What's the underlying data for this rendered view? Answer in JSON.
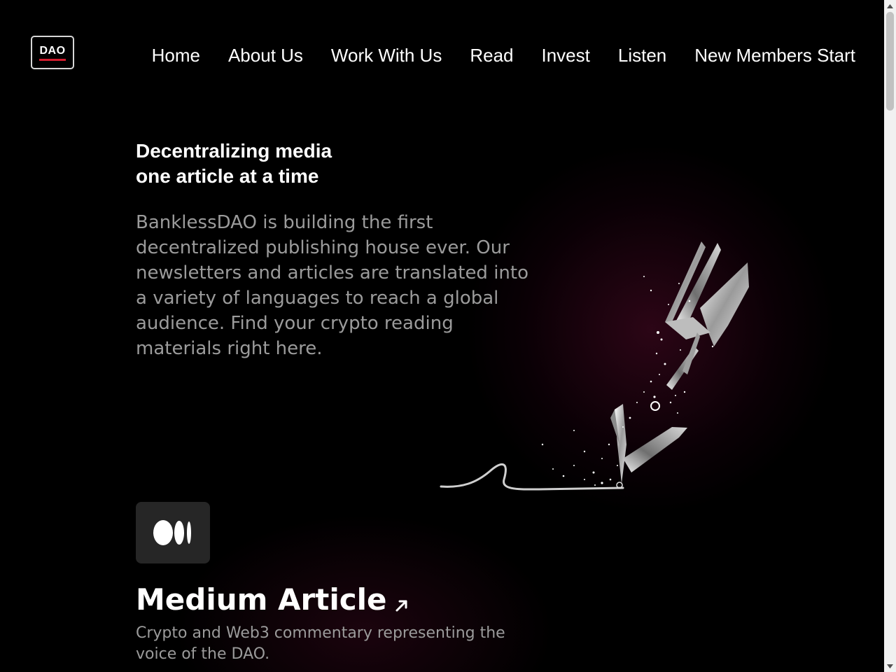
{
  "header": {
    "logo_text": "DAO",
    "nav": [
      {
        "label": "Home"
      },
      {
        "label": "About Us"
      },
      {
        "label": "Work With Us"
      },
      {
        "label": "Read"
      },
      {
        "label": "Invest"
      },
      {
        "label": "Listen"
      },
      {
        "label": "New Members Start"
      }
    ]
  },
  "hero": {
    "title_line1": "Decentralizing media",
    "title_line2": "one article at a time",
    "description": "BanklessDAO is building the first decentralized publishing house ever. Our newsletters and articles are translated into a variety of languages to reach a global audience. Find your crypto reading materials right here.",
    "illustration": "pen-nib-writing-illustration"
  },
  "medium_card": {
    "icon": "medium-logo-icon",
    "title": "Medium Article",
    "link_icon": "external-arrow-icon",
    "description": "Crypto and Web3 commentary representing the voice of the DAO."
  },
  "colors": {
    "background": "#000000",
    "text": "#ffffff",
    "muted_text": "#9b9b9b",
    "logo_accent": "#d41d2f",
    "card_bg": "#262626",
    "glow": "#3c0a1e"
  }
}
